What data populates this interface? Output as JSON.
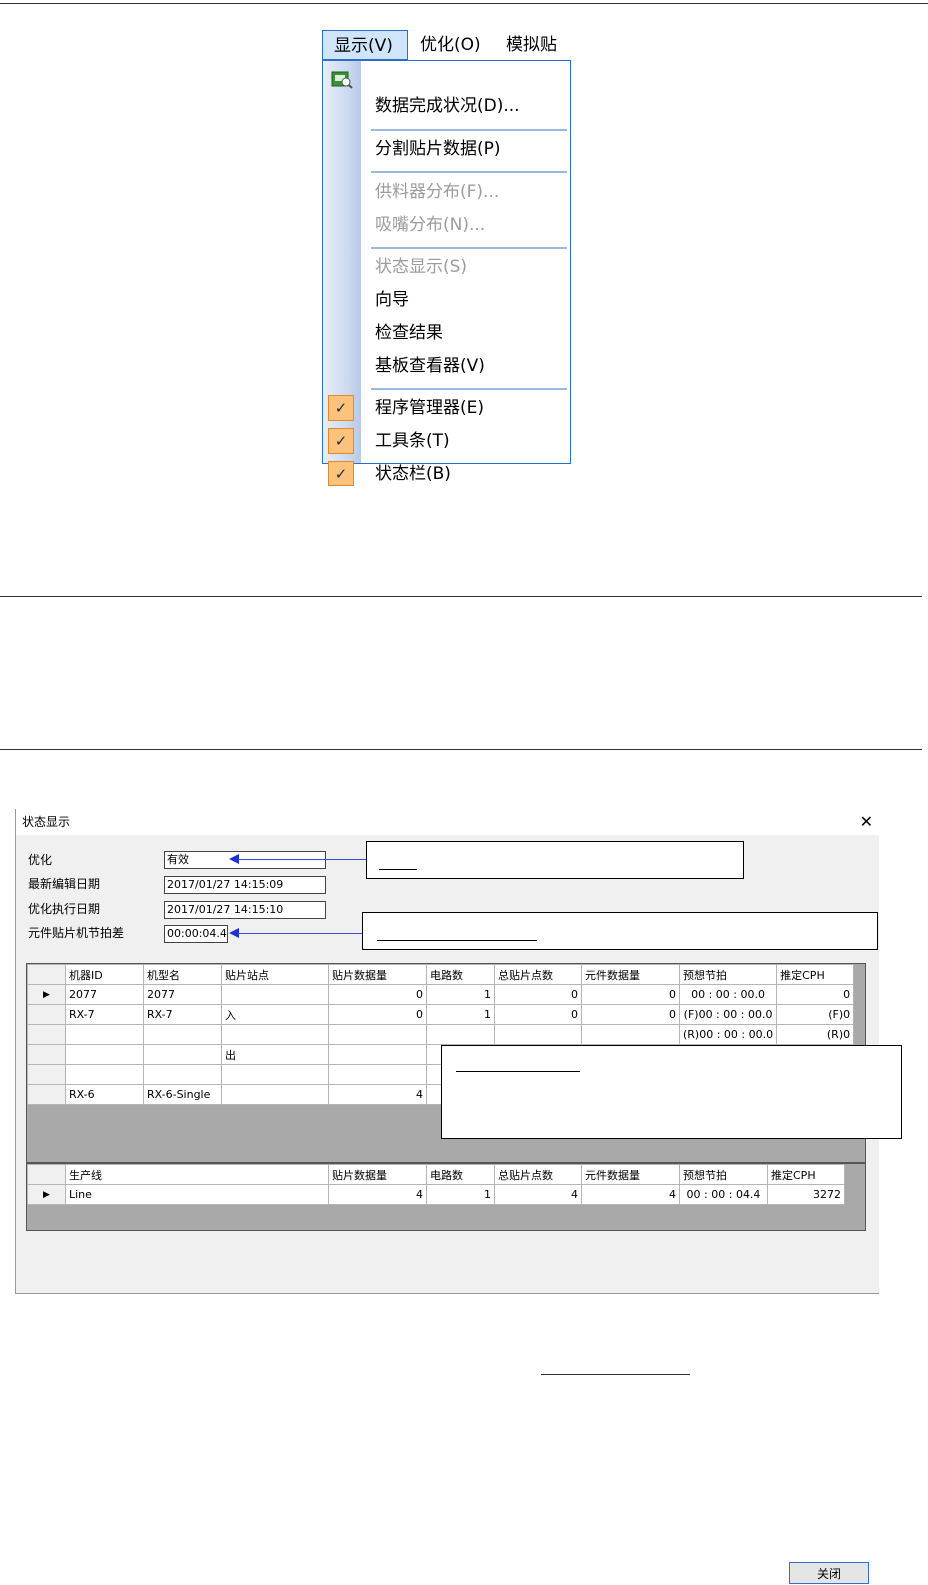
{
  "menu": {
    "bar": [
      "显示(V)",
      "优化(O)",
      "模拟贴片"
    ],
    "items": [
      {
        "label": "数据完成状况(D)...",
        "disabled": false
      },
      {
        "label": "分割贴片数据(P)",
        "disabled": false
      },
      {
        "label": "供料器分布(F)...",
        "disabled": true
      },
      {
        "label": "吸嘴分布(N)...",
        "disabled": true
      },
      {
        "label": "状态显示(S)",
        "disabled": true
      },
      {
        "label": "向导",
        "disabled": false
      },
      {
        "label": "检查结果",
        "disabled": false
      },
      {
        "label": "基板查看器(V)",
        "disabled": false
      },
      {
        "label": "程序管理器(E)",
        "checked": true
      },
      {
        "label": "工具条(T)",
        "checked": true
      },
      {
        "label": "状态栏(B)",
        "checked": true
      }
    ],
    "check_glyph": "✓"
  },
  "dialog": {
    "title": "状态显示",
    "close_glyph": "✕",
    "fields": [
      {
        "label": "优化",
        "value": "有效"
      },
      {
        "label": "最新编辑日期",
        "value": "2017/01/27 14:15:09"
      },
      {
        "label": "优化执行日期",
        "value": "2017/01/27 14:15:10"
      },
      {
        "label": "元件贴片机节拍差",
        "value": "00:00:04.4"
      }
    ],
    "machine_table": {
      "headers": [
        "机器ID",
        "机型名",
        "贴片站点",
        "贴片数据量",
        "电路数",
        "总贴片点数",
        "元件数据量",
        "预想节拍",
        "推定CPH"
      ],
      "rows": [
        [
          "2077",
          "2077",
          "",
          "0",
          "1",
          "0",
          "0",
          "00 : 00 : 00.0",
          "0"
        ],
        [
          "RX-7",
          "RX-7",
          "入",
          "0",
          "1",
          "0",
          "0",
          "(F)00 : 00 : 00.0",
          "(F)0"
        ],
        [
          "",
          "",
          "",
          "",
          "",
          "",
          "",
          "(R)00 : 00 : 00.0",
          "(R)0"
        ],
        [
          "",
          "",
          "出",
          "",
          "",
          "",
          "",
          "",
          ""
        ],
        [
          "",
          "",
          "",
          "",
          "",
          "",
          "",
          "",
          ""
        ],
        [
          "RX-6",
          "RX-6-Single",
          "",
          "4",
          "",
          "",
          "",
          "",
          ""
        ]
      ]
    },
    "line_table": {
      "headers": [
        "生产线",
        "贴片数据量",
        "电路数",
        "总贴片点数",
        "元件数据量",
        "预想节拍",
        "推定CPH"
      ],
      "rows": [
        [
          "Line",
          "4",
          "1",
          "4",
          "4",
          "00 : 00 : 04.4",
          "3272"
        ]
      ]
    },
    "close_button": "关闭"
  },
  "colors": {
    "arrow": "#1f2fd6",
    "menu_border": "#2a6fc9",
    "check_bg": "#ffc27a"
  }
}
